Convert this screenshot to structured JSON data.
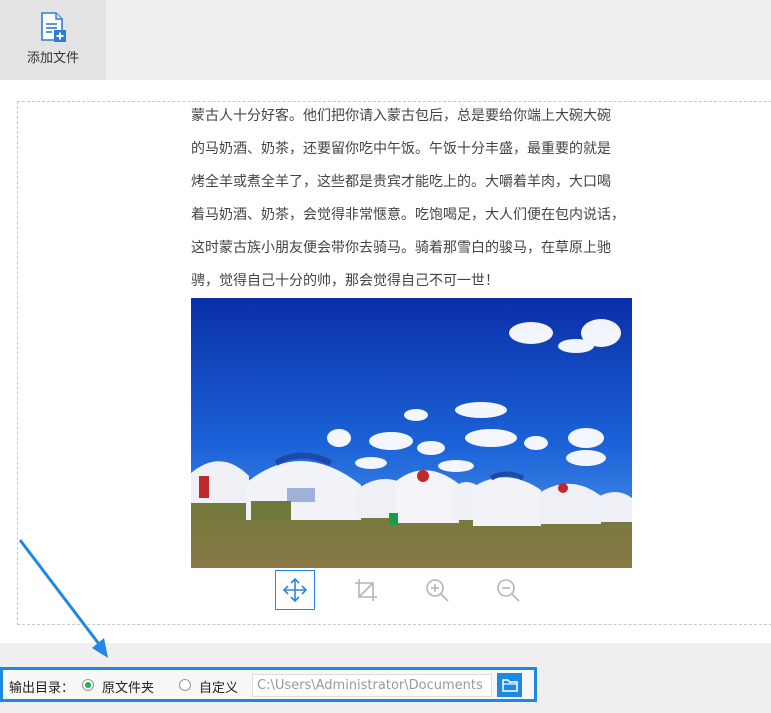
{
  "toolbar": {
    "add_file_label": "添加文件"
  },
  "document": {
    "lines": [
      "蒙古人十分好客。他们把你请入蒙古包后，总是要给你端上大碗大碗",
      "的马奶酒、奶茶，还要留你吃中午饭。午饭十分丰盛，最重要的就是",
      "烤全羊或煮全羊了，这些都是贵宾才能吃上的。大嚼着羊肉，大口喝",
      "着马奶酒、奶茶，会觉得非常惬意。吃饱喝足，大人们便在包内说话，",
      "这时蒙古族小朋友便会带你去骑马。骑着那雪白的骏马，在草原上驰",
      "骋，觉得自己十分的帅，那会觉得自己不可一世！"
    ]
  },
  "image_tools": [
    "move-icon",
    "crop-icon",
    "zoom-in-icon",
    "zoom-out-icon"
  ],
  "output": {
    "label": "输出目录：",
    "option_original": "原文件夹",
    "option_custom": "自定义",
    "path_value": "C:\\Users\\Administrator\\Documents",
    "selected": "original"
  },
  "colors": {
    "accent": "#1e88e5",
    "radio_checked": "#19b35a"
  }
}
